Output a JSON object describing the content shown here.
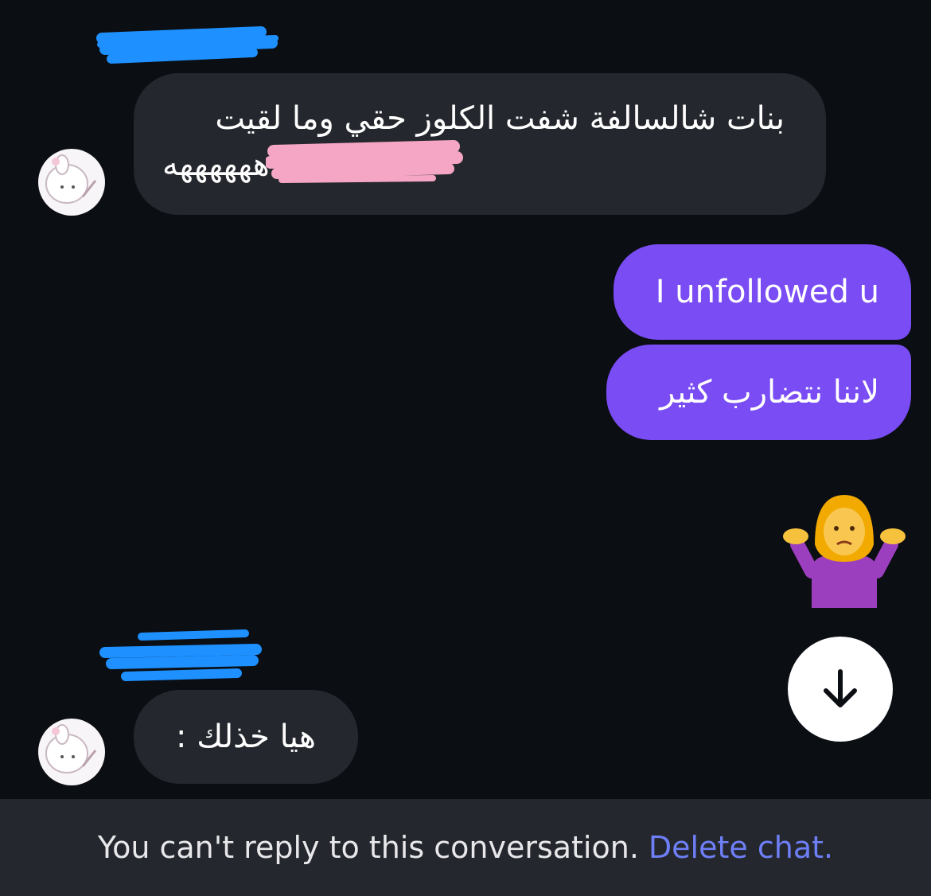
{
  "messages": [
    {
      "direction": "incoming",
      "text": "بنات شالسالفة شفت الكلوز حقي وما لقيت"
    },
    {
      "direction": "incoming",
      "text": "ههههههه"
    },
    {
      "direction": "outgoing",
      "text": "I unfollowed u"
    },
    {
      "direction": "outgoing",
      "text": "لاننا نتضارب كثير"
    },
    {
      "direction": "outgoing",
      "emoji": "person-shrugging"
    },
    {
      "direction": "incoming",
      "text": "هيا خذلك :"
    }
  ],
  "footer": {
    "notice": "You can't reply to this conversation.",
    "action": "Delete chat."
  },
  "colors": {
    "background": "#0b0e13",
    "incoming_bubble": "#24272d",
    "outgoing_bubble": "#7a4cf4",
    "link": "#6e7ff7",
    "redaction_blue": "#1e90ff",
    "redaction_pink": "#f4a6c4"
  },
  "icons": [
    "avatar-icon",
    "shrug-emoji-icon",
    "arrow-down-icon"
  ]
}
